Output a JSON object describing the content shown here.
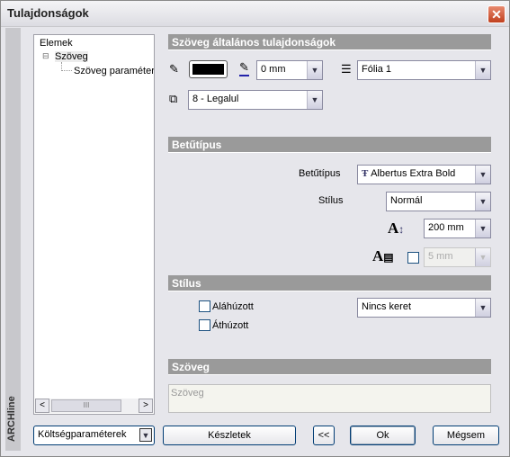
{
  "window": {
    "title": "Tulajdonságok",
    "brand": "ARCHline"
  },
  "tree": {
    "items": [
      "Elemek",
      "Szöveg",
      "Szöveg paraméterei"
    ],
    "expander": "⊟",
    "scroll_thumb": "III"
  },
  "general": {
    "header": "Szöveg általános tulajdonságok",
    "color": "#000000",
    "line_width": "0 mm",
    "layer": "Fólia 1",
    "order": "8 - Legalul"
  },
  "font": {
    "header": "Betűtípus",
    "font_label": "Betűtípus",
    "font_value": "Albertus Extra Bold",
    "style_label": "Stílus",
    "style_value": "Normál",
    "height_value": "200 mm",
    "spacing_value": "5 mm",
    "spacing_checked": false
  },
  "style": {
    "header": "Stílus",
    "underline": "Aláhúzott",
    "strikethrough": "Áthúzott",
    "underline_checked": false,
    "strikethrough_checked": false,
    "frame": "Nincs keret"
  },
  "text": {
    "header": "Szöveg",
    "value": "Szöveg"
  },
  "footer": {
    "cost_params": "Költségparaméterek",
    "sets": "Készletek",
    "back": "<<",
    "ok": "Ok",
    "cancel": "Mégsem"
  }
}
